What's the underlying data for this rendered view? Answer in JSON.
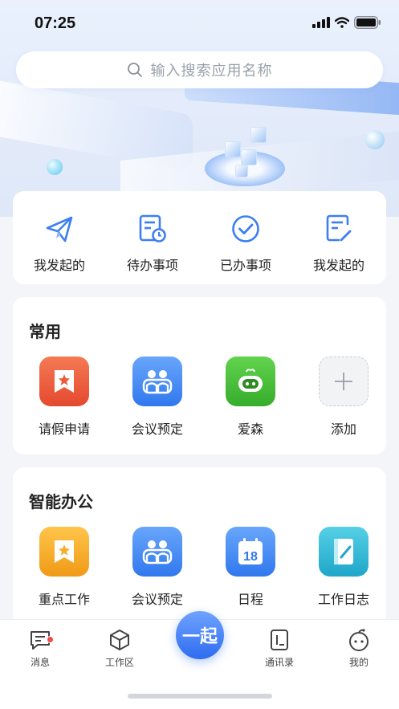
{
  "status_bar": {
    "time": "07:25"
  },
  "search": {
    "placeholder": "输入搜索应用名称",
    "icon": "search-icon"
  },
  "quick_actions": [
    {
      "label": "我发起的",
      "icon": "paper-plane-icon"
    },
    {
      "label": "待办事项",
      "icon": "pending-doc-icon"
    },
    {
      "label": "已办事项",
      "icon": "check-circle-icon"
    },
    {
      "label": "我发起的",
      "icon": "edit-doc-icon"
    }
  ],
  "common": {
    "title": "常用",
    "apps": [
      {
        "label": "请假申请",
        "icon": "bookmark-star-icon",
        "color": "#ec5a3c"
      },
      {
        "label": "会议预定",
        "icon": "meeting-people-icon",
        "color": "#3f8ef2"
      },
      {
        "label": "爱森",
        "icon": "robot-icon",
        "color": "#4cc13e"
      },
      {
        "label": "添加",
        "icon": "plus-icon",
        "color": "#f2f3f5"
      }
    ]
  },
  "smart_office": {
    "title": "智能办公",
    "apps": [
      {
        "label": "重点工作",
        "icon": "bookmark-star-icon",
        "color": "#f5ad2a"
      },
      {
        "label": "会议预定",
        "icon": "meeting-people-icon",
        "color": "#3f8ef2"
      },
      {
        "label": "日程",
        "icon": "calendar-icon",
        "color": "#3f8ef2",
        "glyph": "18"
      },
      {
        "label": "工作日志",
        "icon": "notebook-icon",
        "color": "#2fb6d6"
      }
    ]
  },
  "tab_bar": {
    "items": [
      {
        "label": "消息",
        "icon": "message-icon"
      },
      {
        "label": "工作区",
        "icon": "cube-icon"
      },
      {
        "label": "通讯录",
        "icon": "contacts-icon"
      },
      {
        "label": "我的",
        "icon": "face-icon"
      }
    ],
    "center_label": "一起"
  },
  "colors": {
    "accent": "#3f7ff0",
    "background": "#f3f5f9"
  }
}
